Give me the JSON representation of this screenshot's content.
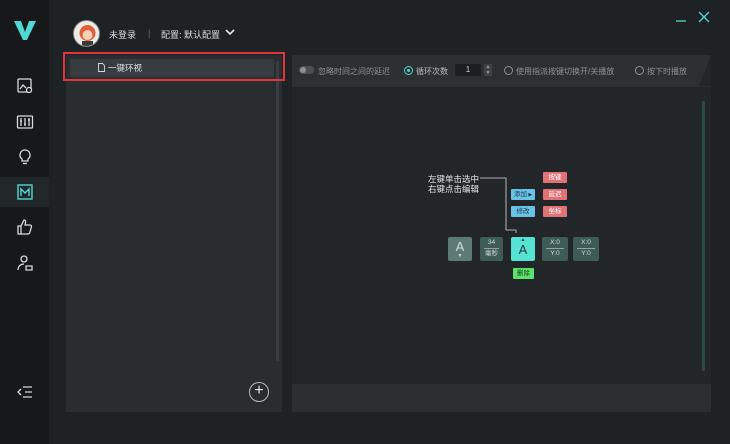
{
  "header": {
    "login_status": "未登录",
    "separator": "|",
    "config_label": "配置: 默认配置"
  },
  "list": {
    "items": [
      {
        "label": "一键环视"
      }
    ]
  },
  "toolbar": {
    "ignore_delay_label": "忽略时间之间的延迟",
    "loop_count_label": "循环次数",
    "loop_count_value": "1",
    "toggle_key_label": "使用指派按键切换开/关播放",
    "press_play_label": "按下时播放"
  },
  "diagram": {
    "hint_line1": "左键单击选中",
    "hint_line2": "右键点击编辑",
    "chip_key": "按键",
    "chip_delay": "延迟",
    "chip_coord": "坐标",
    "chip_add": "添加",
    "chip_edit": "修改",
    "chip_delete": "删除",
    "key_a": "A",
    "delay_value": "34",
    "delay_unit": "毫秒",
    "key_a2": "A",
    "coord1_x": "X:0",
    "coord1_y": "Y:0",
    "coord2_x": "X:0",
    "coord2_y": "Y:0"
  },
  "colors": {
    "accent": "#4fd8d4",
    "highlight_border": "#e0353d",
    "chip_red": "#e07376",
    "chip_blue": "#69c2e8",
    "chip_green": "#5be36b"
  },
  "icons": {
    "logo": "v-logo-icon",
    "nav": [
      "image-settings-icon",
      "sliders-icon",
      "lightbulb-icon",
      "macro-m-icon",
      "thumbs-up-icon",
      "user-settings-icon"
    ],
    "collapse": "collapse-menu-icon",
    "add": "plus-circle-icon"
  }
}
